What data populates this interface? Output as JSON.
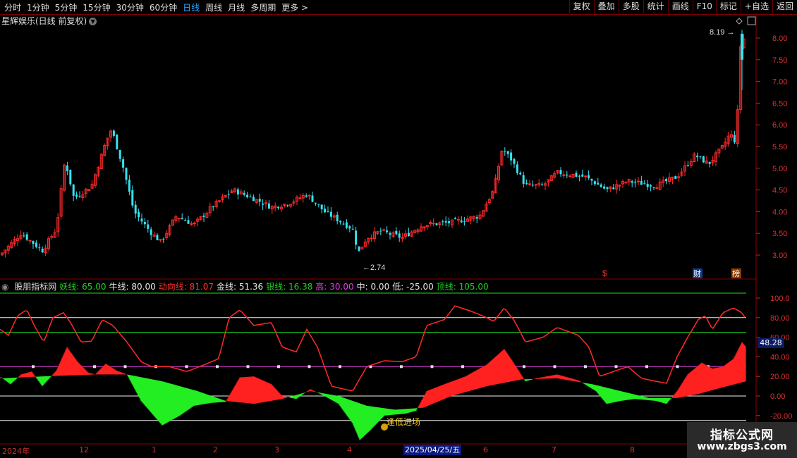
{
  "toolbar": {
    "periods": [
      "分时",
      "1分钟",
      "5分钟",
      "15分钟",
      "30分钟",
      "60分钟",
      "日线",
      "周线",
      "月线",
      "多周期",
      "更多 >"
    ],
    "active_period": "日线",
    "right_buttons": [
      "复权",
      "叠加",
      "多股",
      "统计",
      "画线",
      "F10",
      "标记",
      "+自选",
      "返回"
    ]
  },
  "chart_header": {
    "title": "星辉娱乐(日线 前复权)"
  },
  "price_axis": {
    "labels": [
      "8.00",
      "7.50",
      "7.00",
      "6.50",
      "6.00",
      "5.50",
      "5.00",
      "4.50",
      "4.00",
      "3.50",
      "3.00"
    ]
  },
  "annotations": {
    "high": "8.19",
    "low": "2.74"
  },
  "event_marks": {
    "red": "$",
    "fin": "财",
    "rank": "榜"
  },
  "indicator": {
    "name": "股朋指标网",
    "items": [
      {
        "label": "妖线:",
        "value": "65.00",
        "color": "#1fd01f"
      },
      {
        "label": "牛线:",
        "value": "80.00",
        "color": "#e8e8e8"
      },
      {
        "label": "动向线:",
        "value": "81.07",
        "color": "#ff3030"
      },
      {
        "label": "金线:",
        "value": "51.36",
        "color": "#e8e8e8"
      },
      {
        "label": "银线:",
        "value": "16.38",
        "color": "#1fd01f"
      },
      {
        "label": "高:",
        "value": "30.00",
        "color": "#e040e0"
      },
      {
        "label": "中:",
        "value": "0.00",
        "color": "#e8e8e8"
      },
      {
        "label": "低:",
        "value": "-25.00",
        "color": "#e8e8e8"
      },
      {
        "label": "顶线:",
        "value": "105.00",
        "color": "#1fd01f"
      }
    ],
    "axis": [
      "100.0",
      "80.00",
      "60.00",
      "40.00",
      "20.00",
      "0.00",
      "-20.00"
    ],
    "current": "48.28",
    "signal": "逢低进场"
  },
  "date_axis": {
    "labels": [
      "2024年",
      "12",
      "1",
      "2",
      "3",
      "4",
      "6",
      "7",
      "8"
    ],
    "selected": "2025/04/25/五"
  },
  "brand": {
    "line1": "指标公式网",
    "line2": "www.zbgs3.com"
  }
}
